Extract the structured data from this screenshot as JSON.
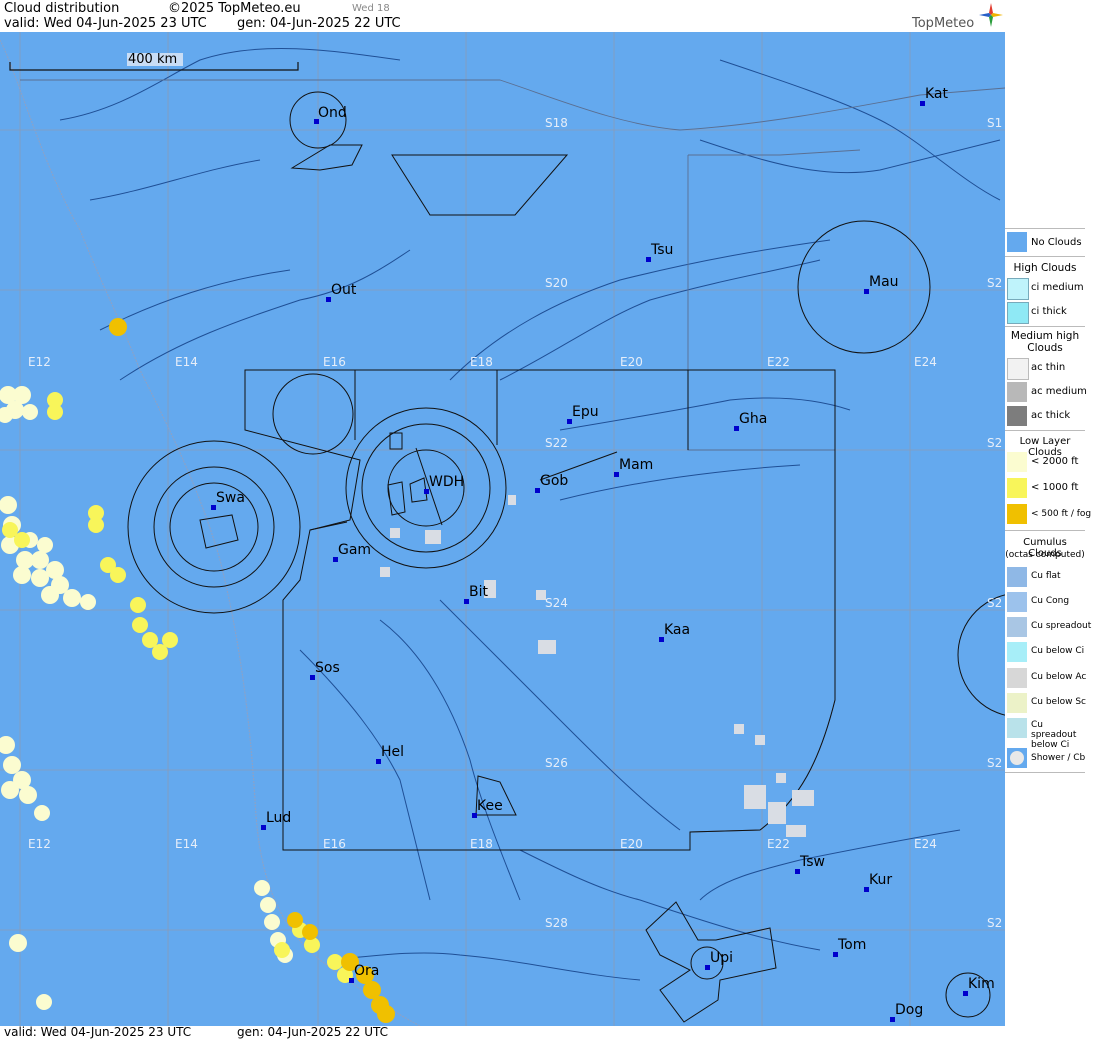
{
  "header": {
    "title": "Cloud distribution",
    "copyright": "©2025 TopMeteo.eu",
    "day_small": "Wed 18",
    "valid": "valid:  Wed  04-Jun-2025  23 UTC",
    "gen": "gen: 04-Jun-2025 22 UTC",
    "logo": "TopMeteo"
  },
  "footer": {
    "valid": "valid:  Wed  04-Jun-2025  23 UTC",
    "gen": "gen: 04-Jun-2025 22 UTC"
  },
  "scale_bar": {
    "label": "400 km"
  },
  "grid_labels": {
    "lon": [
      "E12",
      "E14",
      "E16",
      "E18",
      "E20",
      "E22",
      "E24"
    ],
    "lat": [
      "S18",
      "S20",
      "S22",
      "S24",
      "S26",
      "S28"
    ],
    "lat_edge": [
      "S1",
      "S2",
      "S2",
      "S2",
      "S2",
      "S2"
    ]
  },
  "stations": [
    "Ond",
    "Kat",
    "Tsu",
    "Out",
    "Mau",
    "Epu",
    "Gha",
    "Mam",
    "Swa",
    "WDH",
    "Gob",
    "Gam",
    "Bit",
    "Kaa",
    "Sos",
    "Hel",
    "Lud",
    "Kee",
    "Tsw",
    "Kur",
    "Tom",
    "Upi",
    "Ora",
    "Kim",
    "Dog"
  ],
  "legend": {
    "no_clouds": "No Clouds",
    "high": {
      "title": "High Clouds",
      "items": [
        "ci medium",
        "ci thick"
      ]
    },
    "medium": {
      "title": "Medium high Clouds",
      "items": [
        "ac thin",
        "ac medium",
        "ac thick"
      ]
    },
    "low": {
      "title": "Low Layer Clouds",
      "items": [
        "< 2000 ft",
        "< 1000 ft",
        "< 500 ft / fog"
      ]
    },
    "cumulus": {
      "title": "Cumulus Clouds",
      "subtitle": "(octas computed)",
      "items": [
        "Cu flat",
        "Cu Cong",
        "Cu spreadout",
        "Cu below Ci",
        "Cu below Ac",
        "Cu below Sc",
        "Cu spreadout below Ci",
        "Shower / Cb"
      ]
    }
  },
  "colors": {
    "sea_land": "#64a9ee",
    "low_2000": "#fbfcd0",
    "low_1000": "#f8f55a",
    "low_500": "#f0c000",
    "station": "#0000cc"
  }
}
